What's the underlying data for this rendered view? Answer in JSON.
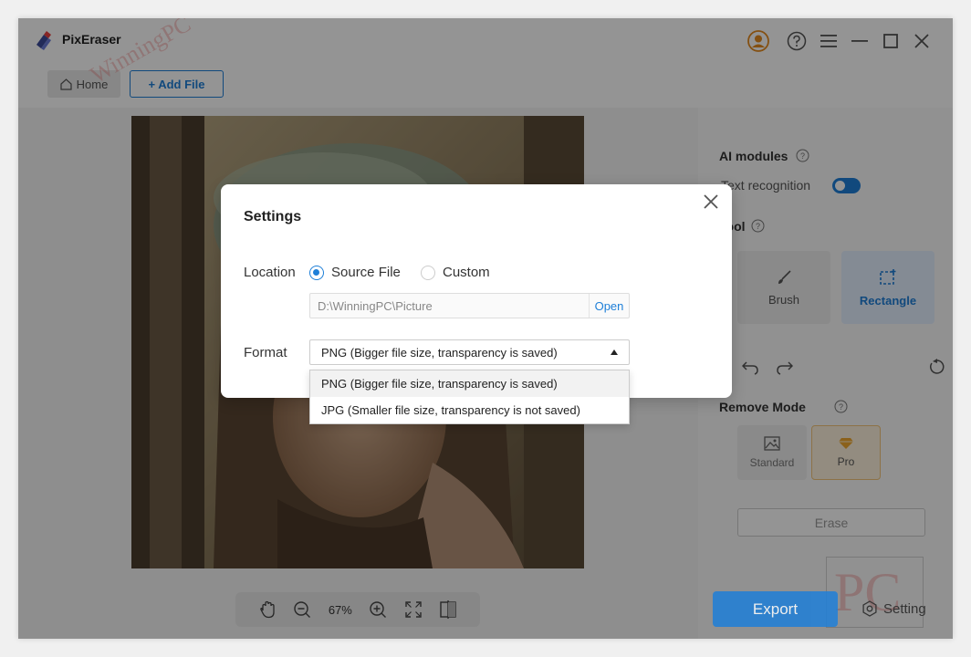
{
  "app": {
    "title": "PixEraser"
  },
  "titlebar": {
    "icons": [
      "user-avatar-icon",
      "help-icon",
      "menu-icon",
      "minimize-icon",
      "maximize-icon",
      "close-icon"
    ]
  },
  "tabs": {
    "home_label": "Home",
    "add_file_label": "+ Add File"
  },
  "watermark": {
    "left_text": "WinningPC",
    "logo_text": "PC"
  },
  "right_panel": {
    "ai_modules_label": "AI modules",
    "text_recognition_label": "Text recognition",
    "text_recognition_enabled": true,
    "tool_label": "Tool",
    "brush_label": "Brush",
    "rectangle_label": "Rectangle",
    "remove_mode_label": "Remove Mode",
    "standard_label": "Standard",
    "pro_label": "Pro",
    "erase_label": "Erase"
  },
  "bottom_toolbar": {
    "zoom": "67%"
  },
  "actions": {
    "export_label": "Export",
    "setting_label": "Setting"
  },
  "dialog": {
    "title": "Settings",
    "location_label": "Location",
    "source_file_label": "Source File",
    "custom_label": "Custom",
    "selected_location": "Source File",
    "path_value": "D:\\WinningPC\\Picture",
    "open_label": "Open",
    "format_label": "Format",
    "format_selected": "PNG (Bigger file size, transparency is saved)",
    "format_options": [
      "PNG (Bigger file size, transparency is saved)",
      "JPG (Smaller file size, transparency is not saved)"
    ]
  },
  "colors": {
    "accent": "#1e7fd8",
    "pro": "#f0a830"
  }
}
